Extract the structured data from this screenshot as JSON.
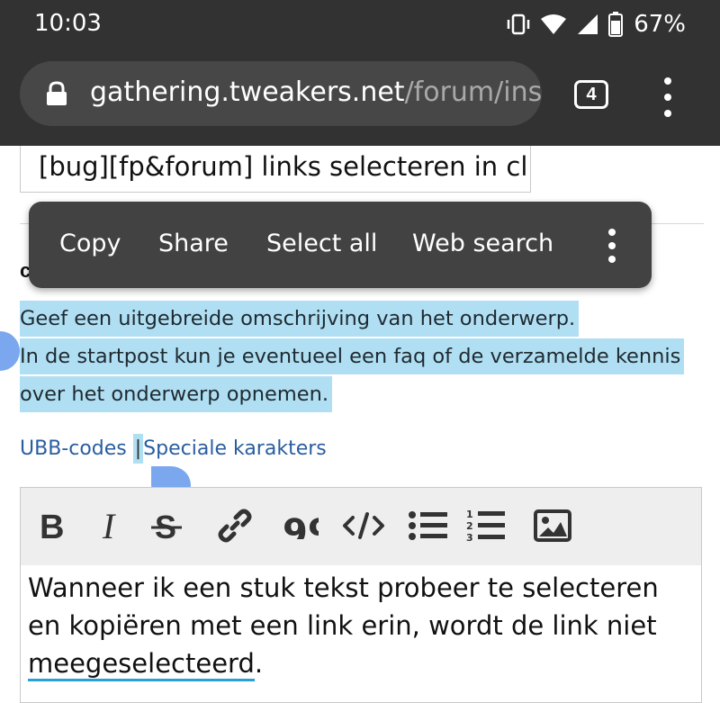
{
  "status_bar": {
    "time": "10:03",
    "battery": "67%",
    "icons": [
      "vibrate-icon",
      "wifi-icon",
      "signal-icon",
      "battery-icon"
    ]
  },
  "browser": {
    "url_host": "gathering.tweakers.net",
    "url_path": "/forum/ins",
    "tab_count": "4",
    "lock_icon": "lock-icon",
    "menu_icon": "more-vert-icon"
  },
  "form": {
    "title_value": "[bug][fp&forum] links selecteren in cl",
    "section_label_partial": "c",
    "description_lines": [
      "Geef een uitgebreide omschrijving van het onderwerp.",
      "In de startpost kun je eventueel een faq of de verzamelde kennis",
      "over het onderwerp opnemen."
    ],
    "ubb_codes_link": "UBB-codes",
    "pipe": "|",
    "special_chars_link": "Speciale karakters"
  },
  "context_menu": {
    "copy": "Copy",
    "share": "Share",
    "select_all": "Select all",
    "web_search": "Web search",
    "more_icon": "more-vert-icon"
  },
  "editor": {
    "toolbar": [
      "bold-icon",
      "italic-icon",
      "strikethrough-icon",
      "link-icon",
      "quote-icon",
      "code-icon",
      "bullet-list-icon",
      "numbered-list-icon",
      "image-icon"
    ],
    "body_text_part1": "Wanneer ik een stuk tekst probeer te selecteren en kopiëren met een link erin, wordt de link niet ",
    "body_text_underlined": "meegeselecteerd",
    "body_text_end": "."
  },
  "colors": {
    "chrome_dark": "#323232",
    "url_bar": "#474747",
    "selection": "#b0dff3",
    "handle": "#7aa7ee",
    "link": "#2a5d9f",
    "context_menu": "#424242"
  }
}
